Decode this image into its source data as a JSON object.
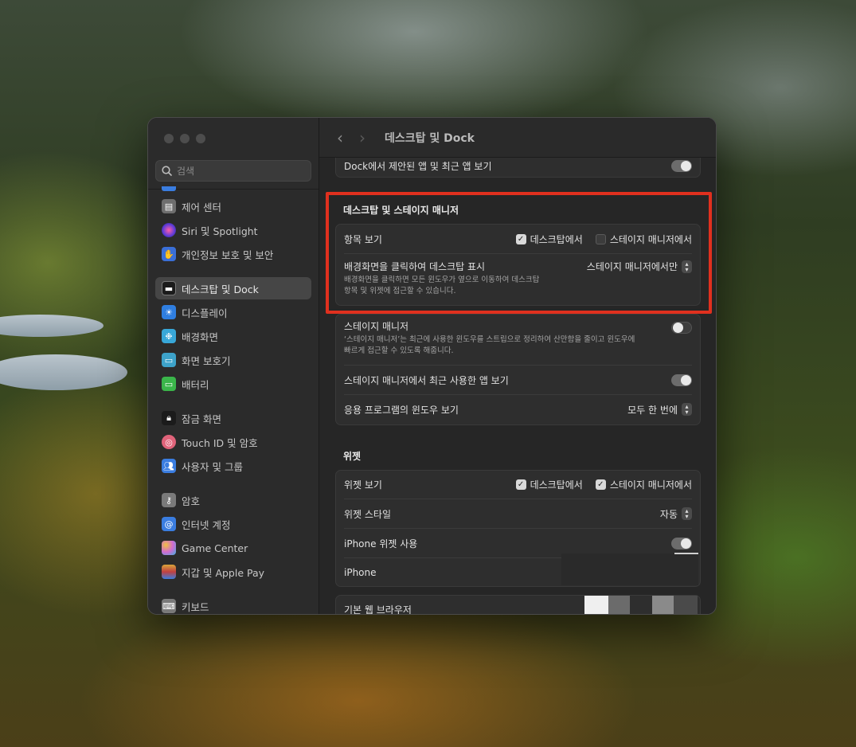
{
  "window": {
    "title": "데스크탑 및 Dock"
  },
  "search": {
    "placeholder": "검색"
  },
  "sidebar": {
    "items": [
      {
        "label": "제어 센터",
        "icon": "control-center-icon",
        "color": "#6e6e6e"
      },
      {
        "label": "Siri 및 Spotlight",
        "icon": "siri-icon",
        "color": "#a050d0"
      },
      {
        "label": "개인정보 보호 및 보안",
        "icon": "hand-icon",
        "color": "#3a6fd8"
      },
      {
        "label": "데스크탑 및 Dock",
        "icon": "dock-icon",
        "color": "#1e1e1e",
        "selected": true
      },
      {
        "label": "디스플레이",
        "icon": "display-icon",
        "color": "#2f7ee0"
      },
      {
        "label": "배경화면",
        "icon": "wallpaper-icon",
        "color": "#38a7d8"
      },
      {
        "label": "화면 보호기",
        "icon": "screensaver-icon",
        "color": "#3da2c9"
      },
      {
        "label": "배터리",
        "icon": "battery-icon",
        "color": "#3ab54a"
      },
      {
        "label": "잠금 화면",
        "icon": "lock-icon",
        "color": "#1e1e1e"
      },
      {
        "label": "Touch ID 및 암호",
        "icon": "fingerprint-icon",
        "color": "#e0637a"
      },
      {
        "label": "사용자 및 그룹",
        "icon": "users-icon",
        "color": "#3a7de0"
      },
      {
        "label": "암호",
        "icon": "key-icon",
        "color": "#7a7a7a"
      },
      {
        "label": "인터넷 계정",
        "icon": "at-icon",
        "color": "#3a7de0"
      },
      {
        "label": "Game Center",
        "icon": "game-center-icon",
        "color": "#d06bd0"
      },
      {
        "label": "지갑 및 Apple Pay",
        "icon": "wallet-icon",
        "color": "#d9a53a"
      },
      {
        "label": "키보드",
        "icon": "keyboard-icon",
        "color": "#7a7a7a"
      }
    ]
  },
  "main": {
    "dock_suggested": {
      "label": "Dock에서 제안된 앱 및 최근 앱 보기",
      "on": true
    },
    "desktop_stage": {
      "title": "데스크탑 및 스테이지 매니저",
      "show_items": {
        "label": "항목 보기",
        "opt1": "데스크탑에서",
        "opt1_checked": true,
        "opt2": "스테이지 매니저에서",
        "opt2_checked": false
      },
      "click_wallpaper": {
        "label": "배경화면을 클릭하여 데스크탑 표시",
        "desc1": "배경화면을 클릭하면 모든 윈도우가 옆으로 이동하여 데스크탑",
        "desc2": "항목 및 위젯에 접근할 수 있습니다.",
        "value": "스테이지 매니저에서만"
      }
    },
    "stage_manager": {
      "label": "스테이지 매니저",
      "desc1": "‘스테이지 매니저’는 최근에 사용한 윈도우를 스트립으로 정리하여 산만함을 줄이고 윈도우에",
      "desc2": "빠르게 접근할 수 있도록 해줍니다.",
      "on": false,
      "recent_apps": {
        "label": "스테이지 매니저에서 최근 사용한 앱 보기",
        "on": true
      },
      "app_windows": {
        "label": "응용 프로그램의 윈도우 보기",
        "value": "모두 한 번에"
      }
    },
    "widgets": {
      "title": "위젯",
      "show": {
        "label": "위젯 보기",
        "opt1": "데스크탑에서",
        "opt1_checked": true,
        "opt2": "스테이지 매니저에서",
        "opt2_checked": true
      },
      "style": {
        "label": "위젯 스타일",
        "value": "자동"
      },
      "iphone_widgets": {
        "label": "iPhone 위젯 사용",
        "on": true
      },
      "iphone": {
        "label": "iPhone"
      }
    },
    "browser": {
      "label": "기본 웹 브라우저"
    }
  },
  "colors": {
    "highlight": "#e0301e",
    "window_bg": "#262626",
    "sidebar_bg": "#2b2b2b"
  }
}
